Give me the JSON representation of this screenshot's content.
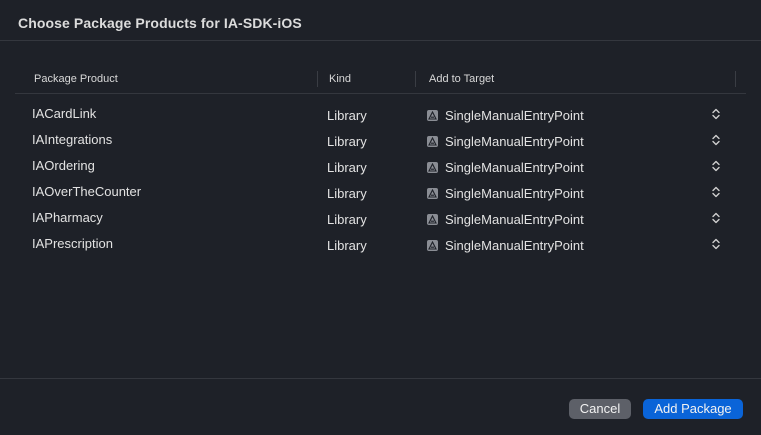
{
  "dialog": {
    "title": "Choose Package Products for IA-SDK-iOS"
  },
  "table": {
    "headers": {
      "product": "Package Product",
      "kind": "Kind",
      "target": "Add to Target"
    },
    "rows": [
      {
        "product": "IACardLink",
        "kind": "Library",
        "target": "SingleManualEntryPoint"
      },
      {
        "product": "IAIntegrations",
        "kind": "Library",
        "target": "SingleManualEntryPoint"
      },
      {
        "product": "IAOrdering",
        "kind": "Library",
        "target": "SingleManualEntryPoint"
      },
      {
        "product": "IAOverTheCounter",
        "kind": "Library",
        "target": "SingleManualEntryPoint"
      },
      {
        "product": "IAPharmacy",
        "kind": "Library",
        "target": "SingleManualEntryPoint"
      },
      {
        "product": "IAPrescription",
        "kind": "Library",
        "target": "SingleManualEntryPoint"
      }
    ]
  },
  "footer": {
    "cancel_label": "Cancel",
    "add_label": "Add Package"
  },
  "colors": {
    "background": "#1e2128",
    "accent": "#0a64d8",
    "secondary_button": "#5d6068"
  }
}
